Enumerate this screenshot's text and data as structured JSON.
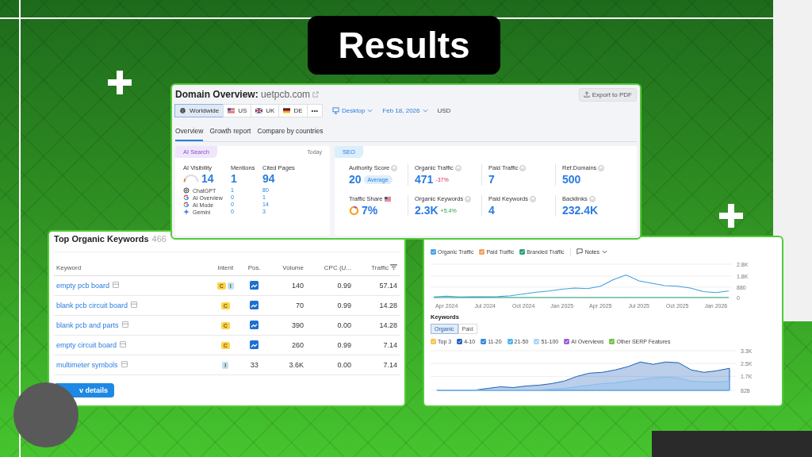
{
  "title": "Results",
  "overview": {
    "heading": "Domain Overview:",
    "domain": "uetpcb.com",
    "export": "Export to PDF",
    "regions": [
      {
        "label": "Worldwide",
        "kind": "globe",
        "selected": true
      },
      {
        "label": "US",
        "kind": "us",
        "selected": false
      },
      {
        "label": "UK",
        "kind": "uk",
        "selected": false
      },
      {
        "label": "DE",
        "kind": "de",
        "selected": false
      },
      {
        "label": "•••",
        "kind": "more",
        "selected": false
      }
    ],
    "device": "Desktop",
    "date": "Feb 18, 2026",
    "currency": "USD",
    "tabs": [
      {
        "label": "Overview",
        "selected": true
      },
      {
        "label": "Growth report",
        "selected": false
      },
      {
        "label": "Compare by countries",
        "selected": false
      }
    ],
    "ai": {
      "badge": "AI Search",
      "when": "Today",
      "columns": [
        "AI Visibility",
        "Mentions",
        "Cited Pages"
      ],
      "totals": [
        "14",
        "1",
        "94"
      ],
      "rows": [
        {
          "source": "ChatGPT",
          "kind": "chatgpt",
          "mentions": "1",
          "cited": "80"
        },
        {
          "source": "AI Overview",
          "kind": "google",
          "mentions": "0",
          "cited": "1"
        },
        {
          "source": "AI Mode",
          "kind": "google",
          "mentions": "0",
          "cited": "14"
        },
        {
          "source": "Gemini",
          "kind": "gemini",
          "mentions": "0",
          "cited": "3"
        }
      ]
    },
    "seo": {
      "badge": "SEO",
      "metrics": [
        {
          "label": "Authority Score",
          "value": "20",
          "note": "Average",
          "kind": "pill"
        },
        {
          "label": "Organic Traffic",
          "value": "471",
          "note": "-37%",
          "kind": "down"
        },
        {
          "label": "Paid Traffic",
          "value": "7",
          "kind": "plain"
        },
        {
          "label": "Ref.Domains",
          "value": "500",
          "kind": "plain"
        },
        {
          "label": "Traffic Share",
          "value": "7%",
          "kind": "share"
        },
        {
          "label": "Organic Keywords",
          "value": "2.3K",
          "note": "+5.4%",
          "kind": "up"
        },
        {
          "label": "Paid Keywords",
          "value": "4",
          "kind": "plain"
        },
        {
          "label": "Backlinks",
          "value": "232.4K",
          "kind": "plain"
        }
      ]
    }
  },
  "keywords": {
    "title": "Top Organic Keywords",
    "count": "466",
    "columns": [
      "Keyword",
      "Intent",
      "Pos.",
      "Volume",
      "CPC (U...",
      "Traffic"
    ],
    "rows": [
      {
        "keyword": "empty pcb board",
        "intents": [
          {
            "letter": "C",
            "color": "#fcd34d"
          },
          {
            "letter": "I",
            "color": "#bfe0fb"
          }
        ],
        "pos": {
          "kind": "serp"
        },
        "volume": "140",
        "cpc": "0.99",
        "traffic": "57.14"
      },
      {
        "keyword": "blank pcb circuit board",
        "intents": [
          {
            "letter": "C",
            "color": "#fcd34d"
          }
        ],
        "pos": {
          "kind": "serp"
        },
        "volume": "70",
        "cpc": "0.99",
        "traffic": "14.28"
      },
      {
        "keyword": "blank pcb and parts",
        "intents": [
          {
            "letter": "C",
            "color": "#fcd34d"
          }
        ],
        "pos": {
          "kind": "serp"
        },
        "volume": "390",
        "cpc": "0.00",
        "traffic": "14.28"
      },
      {
        "keyword": "empty circuit board",
        "intents": [
          {
            "letter": "C",
            "color": "#fcd34d"
          }
        ],
        "pos": {
          "kind": "serp"
        },
        "volume": "260",
        "cpc": "0.99",
        "traffic": "7.14"
      },
      {
        "keyword": "multimeter symbols",
        "intents": [
          {
            "letter": "I",
            "color": "#bfe0fb"
          }
        ],
        "pos": {
          "kind": "text",
          "text": "33"
        },
        "volume": "3.6K",
        "cpc": "0.00",
        "traffic": "7.14"
      }
    ],
    "button": "v details"
  },
  "trend": {
    "legend": [
      {
        "label": "Organic Traffic",
        "color": "#3b9fe8",
        "checked": true
      },
      {
        "label": "Paid Traffic",
        "color": "#f59a56",
        "checked": true
      },
      {
        "label": "Branded Traffic",
        "color": "#1f9b7a",
        "checked": true
      }
    ],
    "notes": "Notes",
    "chart_data": {
      "type": "line",
      "categories": [
        null,
        "Apr 2024",
        null,
        null,
        "Jul 2024",
        null,
        null,
        "Oct 2024",
        null,
        null,
        "Jan 2025",
        null,
        null,
        "Apr 2025",
        null,
        null,
        "Jul 2025",
        null,
        null,
        "Oct 2025",
        null,
        null,
        "Jan 2026",
        null
      ],
      "series": [
        {
          "color": "#3b9fe8",
          "values": [
            50,
            120,
            50,
            60,
            60,
            70,
            150,
            300,
            450,
            550,
            700,
            800,
            750,
            950,
            1500,
            1900,
            1400,
            1200,
            1000,
            950,
            800,
            500,
            420,
            550
          ]
        },
        {
          "color": "#1f9b7a",
          "values": [
            0,
            0,
            0,
            0,
            0,
            0,
            0,
            0,
            0,
            0,
            0,
            0,
            0,
            0,
            0,
            0,
            0,
            0,
            0,
            0,
            0,
            0,
            0,
            0
          ]
        }
      ],
      "ylim": [
        0,
        2800
      ],
      "yticks": [
        0,
        {
          "value": 880,
          "label": "880"
        },
        {
          "value": 1800,
          "label": "1.8K"
        },
        {
          "value": 2800,
          "label": "2.8K"
        }
      ]
    }
  },
  "kw": {
    "heading": "Keywords",
    "toggle": [
      {
        "label": "Organic",
        "selected": true
      },
      {
        "label": "Paid",
        "selected": false
      }
    ],
    "legend": [
      {
        "label": "Top 3",
        "color": "#f5c242",
        "checked": true
      },
      {
        "label": "4-10",
        "color": "#1d5fb8",
        "checked": true
      },
      {
        "label": "11-20",
        "color": "#2b86d9",
        "checked": true
      },
      {
        "label": "21-50",
        "color": "#4ab0ee",
        "checked": true
      },
      {
        "label": "51-100",
        "color": "#a9d4f5",
        "checked": true
      },
      {
        "label": "AI Overviews",
        "color": "#9b59d6",
        "checked": true
      },
      {
        "label": "Other SERP Features",
        "color": "#6cbf3a",
        "checked": true
      }
    ],
    "chart_data": {
      "type": "area",
      "series": [
        {
          "color": "#1d5fb8",
          "values": [
            850,
            850,
            850,
            850,
            950,
            1050,
            1000,
            1100,
            1150,
            1250,
            1400,
            1700,
            1900,
            1950,
            2100,
            2300,
            2600,
            2450,
            2600,
            2550,
            2100,
            1950,
            2050,
            2200
          ]
        },
        {
          "color": "#7fbcef",
          "values": [
            850,
            850,
            850,
            850,
            850,
            850,
            850,
            850,
            850,
            900,
            950,
            1050,
            1150,
            1250,
            1300,
            1400,
            1500,
            1600,
            1650,
            1600,
            1400,
            1350,
            1350,
            1400
          ]
        }
      ],
      "ylim": [
        828,
        3300
      ],
      "yticks": [
        {
          "value": 828,
          "label": "828"
        },
        {
          "value": 1700,
          "label": "1.7K"
        },
        {
          "value": 2500,
          "label": "2.5K"
        },
        {
          "value": 3300,
          "label": "3.3K"
        }
      ]
    }
  }
}
